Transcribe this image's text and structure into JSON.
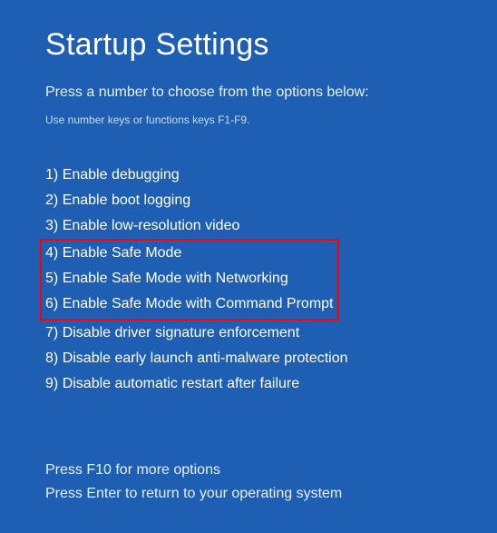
{
  "title": "Startup Settings",
  "subtitle": "Press a number to choose from the options below:",
  "hint": "Use number keys or functions keys F1-F9.",
  "options": [
    {
      "num": "1",
      "label": "Enable debugging"
    },
    {
      "num": "2",
      "label": "Enable boot logging"
    },
    {
      "num": "3",
      "label": "Enable low-resolution video"
    },
    {
      "num": "4",
      "label": "Enable Safe Mode"
    },
    {
      "num": "5",
      "label": "Enable Safe Mode with Networking"
    },
    {
      "num": "6",
      "label": "Enable Safe Mode with Command Prompt"
    },
    {
      "num": "7",
      "label": "Disable driver signature enforcement"
    },
    {
      "num": "8",
      "label": "Disable early launch anti-malware protection"
    },
    {
      "num": "9",
      "label": "Disable automatic restart after failure"
    }
  ],
  "highlighted_indices": [
    3,
    4,
    5
  ],
  "footer": {
    "more": "Press F10 for more options",
    "return": "Press Enter to return to your operating system"
  }
}
